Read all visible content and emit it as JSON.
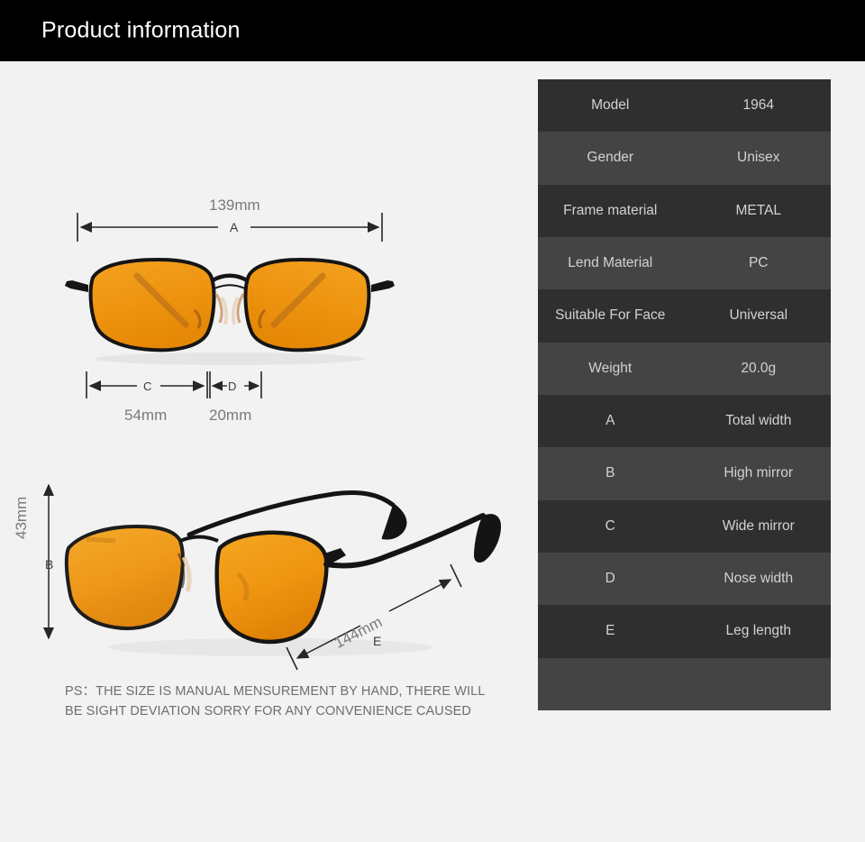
{
  "header": {
    "title": "Product information"
  },
  "spec_table": {
    "rows": [
      {
        "label": "Model",
        "value": "1964"
      },
      {
        "label": "Gender",
        "value": "Unisex"
      },
      {
        "label": "Frame material",
        "value": "METAL"
      },
      {
        "label": "Lend Material",
        "value": "PC"
      },
      {
        "label": "Suitable For Face",
        "value": "Universal"
      },
      {
        "label": "Weight",
        "value": "20.0g"
      },
      {
        "label": "A",
        "value": "Total width"
      },
      {
        "label": "B",
        "value": "High mirror"
      },
      {
        "label": "C",
        "value": "Wide mirror"
      },
      {
        "label": "D",
        "value": "Nose width"
      },
      {
        "label": "E",
        "value": "Leg length"
      },
      {
        "label": "",
        "value": ""
      }
    ]
  },
  "diagram": {
    "front_view_alt": "sunglasses-front-view",
    "side_view_alt": "sunglasses-angled-side-view",
    "dimensions": {
      "a": {
        "letter": "A",
        "value": "139mm",
        "meaning": "Total width"
      },
      "b": {
        "letter": "B",
        "value": "43mm",
        "meaning": "High mirror"
      },
      "c": {
        "letter": "C",
        "value": "54mm",
        "meaning": "Wide mirror"
      },
      "d": {
        "letter": "D",
        "value": "20mm",
        "meaning": "Nose width"
      },
      "e": {
        "letter": "E",
        "value": "144mm",
        "meaning": "Leg length"
      }
    }
  },
  "note": {
    "line1": "PS：THE SIZE IS MANUAL MENSUREMENT BY HAND, THERE WILL",
    "line2": "BE SIGHT DEVIATION SORRY FOR ANY CONVENIENCE CAUSED"
  },
  "colors": {
    "header_bg": "#000000",
    "page_bg": "#f2f2f2",
    "row_dark": "#2f2f2f",
    "row_light": "#444444",
    "row_text": "#d2d2d2",
    "lens_orange": "#ee9410",
    "frame_black": "#1a1a1a",
    "dim_line": "#262626",
    "dim_text": "#7a7a7a"
  }
}
